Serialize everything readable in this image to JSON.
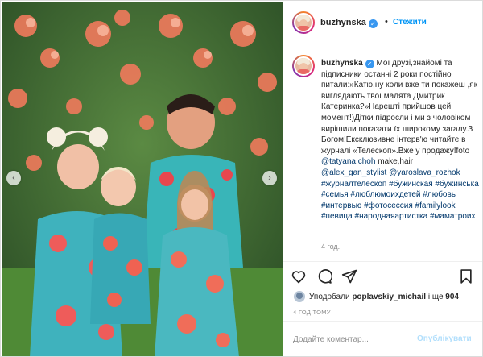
{
  "post": {
    "author": "buzhynska",
    "follow_label": "Стежити",
    "dot": "•",
    "photo_alt": "Family photo in floral outfits in front of a flowering rose bush"
  },
  "caption": {
    "username": "buzhynska",
    "segments": [
      {
        "type": "text",
        "value": " Мої друзі,знайомі та підписники останні 2 роки постійно питали:»Катю,ну коли вже ти покажеш ,як виглядають твої малята Дмитрик і Катеринка?»Нарешті прийшов цей момент!)Дітки підросли і ми з чоловіком вирішили показати їх широкому загалу.З Богом!Ексклюзивне інтерв'ю читайте в журналі «Телескоп».Вже у продажу!foto "
      },
      {
        "type": "mention",
        "value": "@tatyana.choh"
      },
      {
        "type": "text",
        "value": " make,hair "
      },
      {
        "type": "mention",
        "value": "@alex_gan_stylist"
      },
      {
        "type": "text",
        "value": " "
      },
      {
        "type": "mention",
        "value": "@yaroslava_rozhok"
      },
      {
        "type": "text",
        "value": " "
      },
      {
        "type": "hashtag",
        "value": "#журналтелескоп"
      },
      {
        "type": "text",
        "value": " "
      },
      {
        "type": "hashtag",
        "value": "#бужинская"
      },
      {
        "type": "text",
        "value": " "
      },
      {
        "type": "hashtag",
        "value": "#бужинська"
      },
      {
        "type": "text",
        "value": " "
      },
      {
        "type": "hashtag",
        "value": "#семья"
      },
      {
        "type": "text",
        "value": " "
      },
      {
        "type": "hashtag",
        "value": "#люблюмоихдетей"
      },
      {
        "type": "text",
        "value": " "
      },
      {
        "type": "hashtag",
        "value": "#любовь"
      },
      {
        "type": "text",
        "value": " "
      },
      {
        "type": "hashtag",
        "value": "#интервью"
      },
      {
        "type": "text",
        "value": " "
      },
      {
        "type": "hashtag",
        "value": "#фотосессия"
      },
      {
        "type": "text",
        "value": " "
      },
      {
        "type": "hashtag",
        "value": "#familylook"
      },
      {
        "type": "text",
        "value": " "
      },
      {
        "type": "hashtag",
        "value": "#певица"
      },
      {
        "type": "text",
        "value": " "
      },
      {
        "type": "hashtag",
        "value": "#народнаяартистка"
      },
      {
        "type": "text",
        "value": " "
      },
      {
        "type": "hashtag",
        "value": "#маматроих"
      }
    ],
    "time": "4 год."
  },
  "actions": {
    "like_icon": "heart-icon",
    "comment_icon": "comment-icon",
    "share_icon": "share-icon",
    "save_icon": "bookmark-icon"
  },
  "likes": {
    "prefix": "Уподобали ",
    "user": "poplavskiy_michail",
    "suffix": " і ще ",
    "count": "904"
  },
  "posted_ago": "4 ГОД ТОМУ",
  "comment": {
    "placeholder": "Додайте коментар...",
    "publish_label": "Опублікувати"
  },
  "nav": {
    "prev": "‹",
    "next": "›"
  },
  "colors": {
    "accent": "#0095f6",
    "link": "#00376b",
    "verified": "#3897f0"
  }
}
